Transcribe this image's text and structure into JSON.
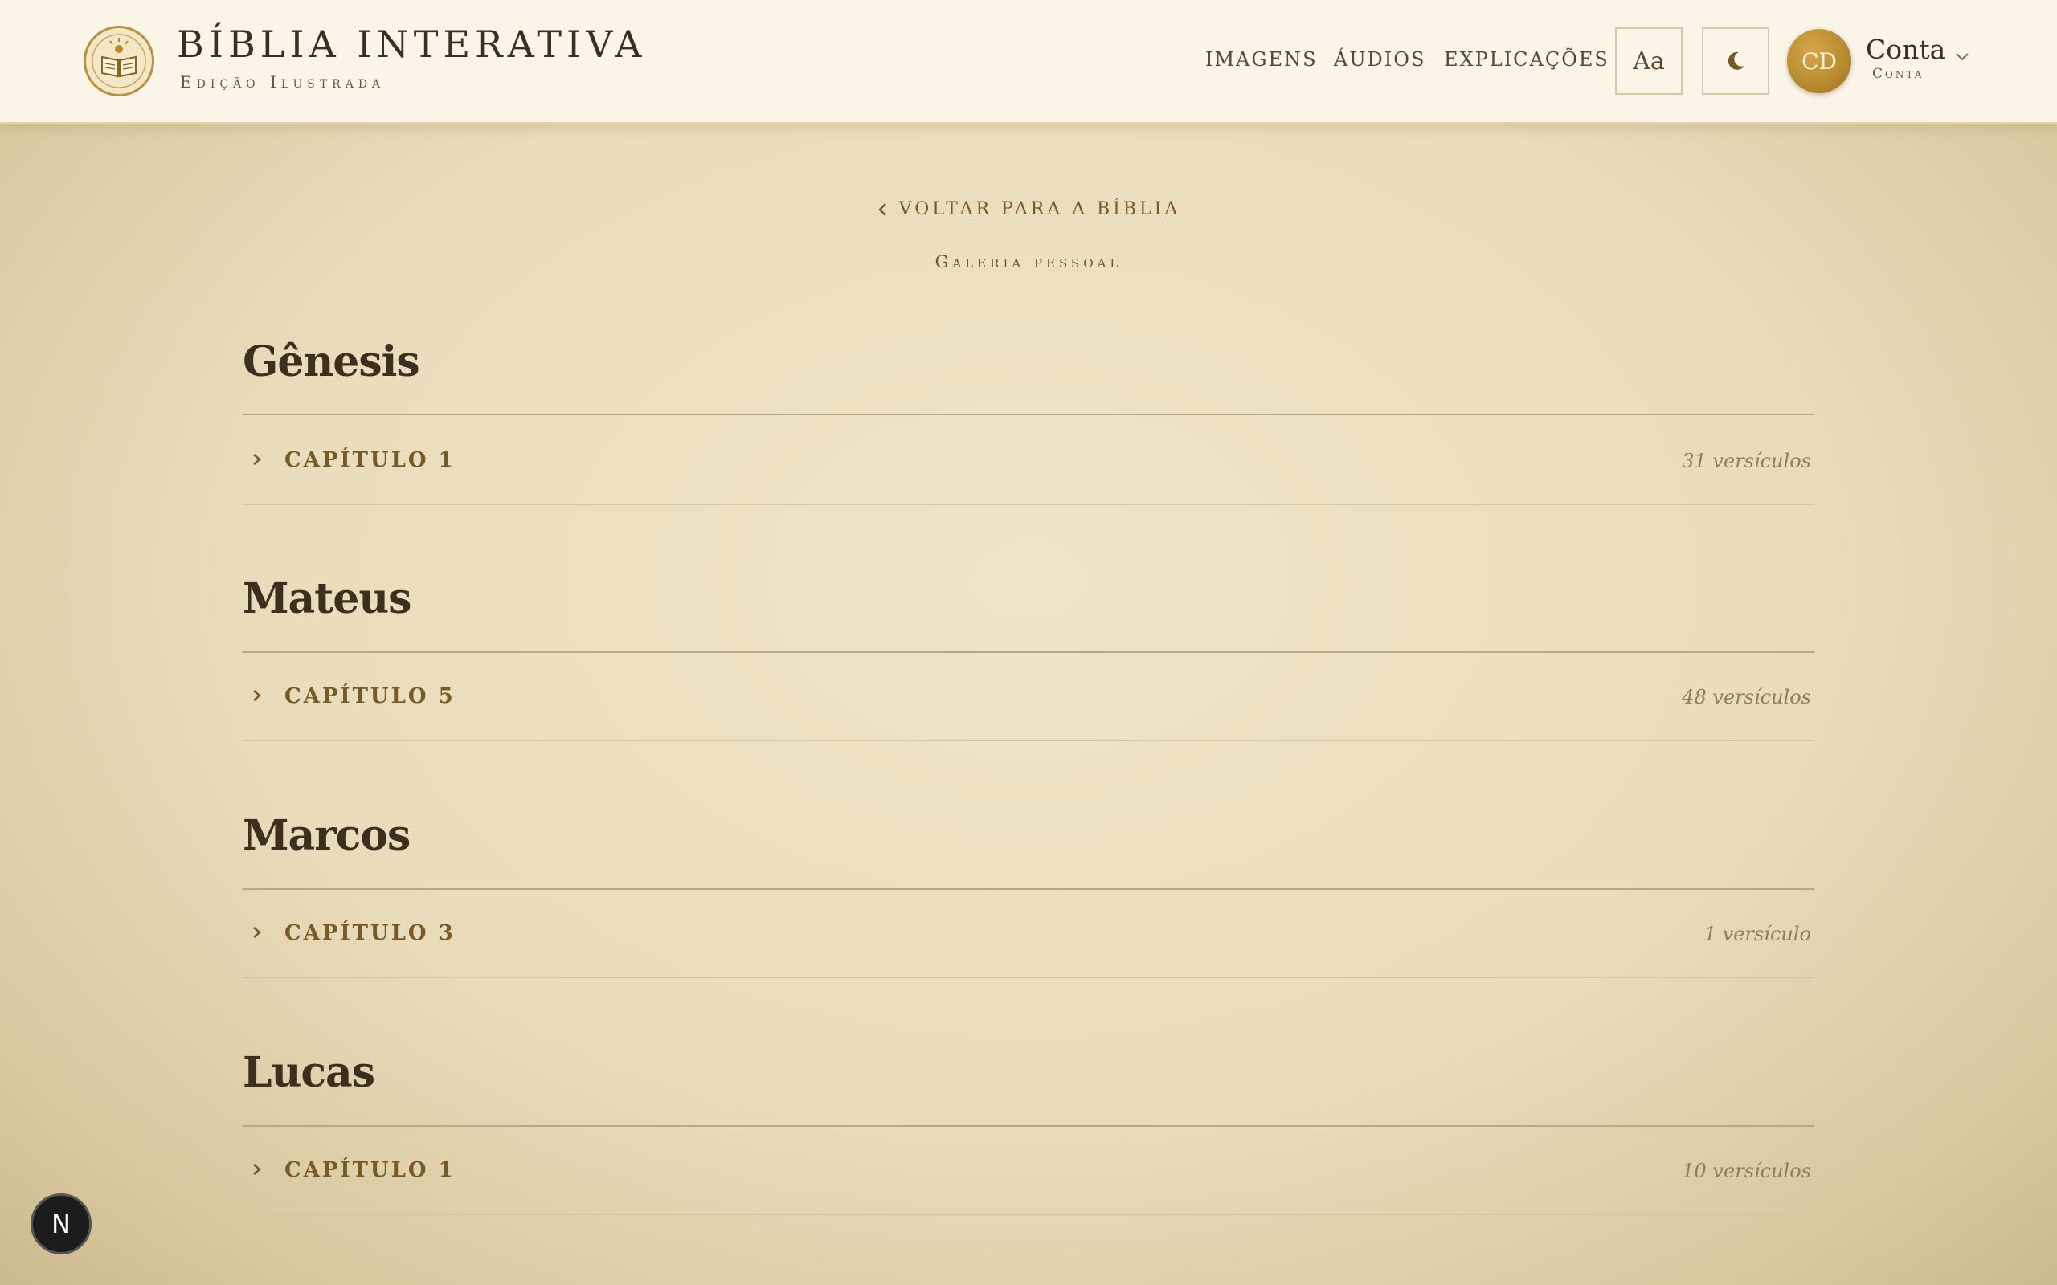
{
  "header": {
    "brand_title": "BÍBLIA INTERATIVA",
    "brand_subtitle": "Edição Ilustrada",
    "nav": [
      "IMAGENS",
      "ÁUDIOS",
      "EXPLICAÇÕES"
    ],
    "font_button_label": "Aa",
    "theme_button_icon": "moon-icon",
    "account": {
      "initials": "CD",
      "name": "Conta",
      "subtitle": "Conta"
    }
  },
  "main": {
    "back_label": "VOLTAR PARA A BÍBLIA",
    "gallery_label": "Galeria pessoal",
    "books": [
      {
        "title": "Gênesis",
        "chapter": "CAPÍTULO 1",
        "verses": "31 versículos"
      },
      {
        "title": "Mateus",
        "chapter": "CAPÍTULO 5",
        "verses": "48 versículos"
      },
      {
        "title": "Marcos",
        "chapter": "CAPÍTULO 3",
        "verses": "1 versículo"
      },
      {
        "title": "Lucas",
        "chapter": "CAPÍTULO 1",
        "verses": "10 versículos"
      }
    ]
  },
  "dev_badge": "N",
  "colors": {
    "accent": "#b88a2e",
    "link": "#7a5a24",
    "background": "#e9dcbb",
    "header": "#fbf5e7"
  }
}
